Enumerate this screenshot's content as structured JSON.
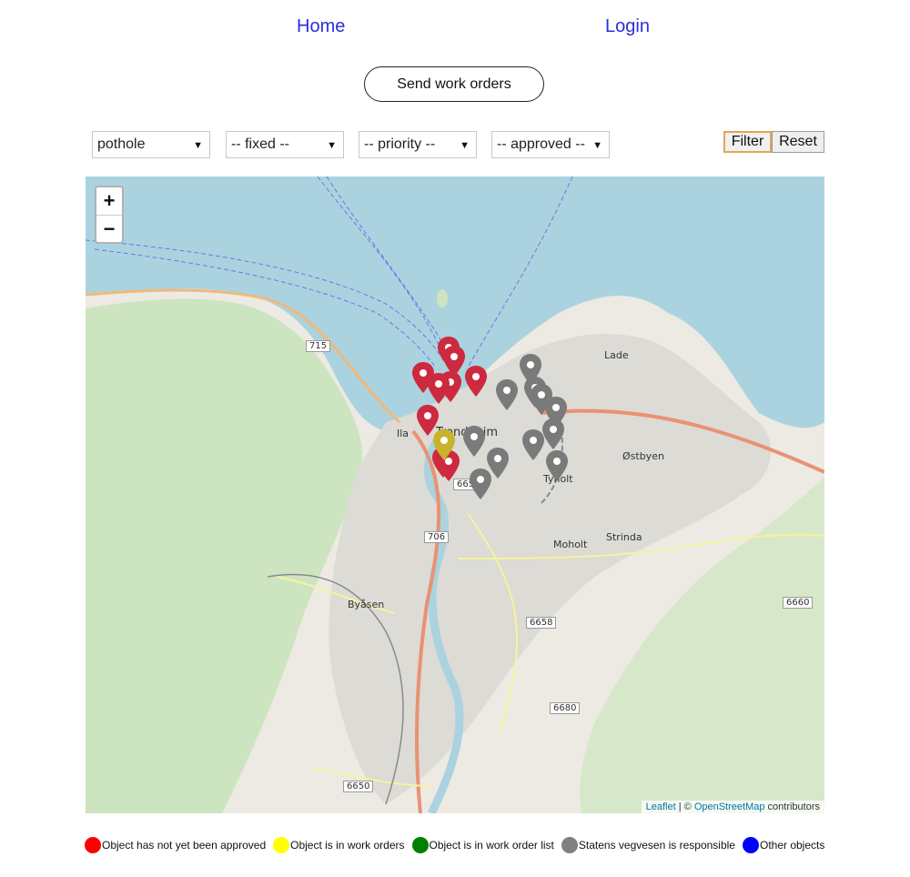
{
  "nav": {
    "home": "Home",
    "login": "Login"
  },
  "send_button": "Send work orders",
  "filters": {
    "category": "pothole",
    "fixed": "-- fixed --",
    "priority": "-- priority --",
    "approved": "-- approved --"
  },
  "buttons": {
    "filter": "Filter",
    "reset": "Reset"
  },
  "map": {
    "zoom_in": "+",
    "zoom_out": "−",
    "attribution": {
      "leaflet": "Leaflet",
      "sep": " | © ",
      "osm": "OpenStreetMap",
      "suffix": " contributors"
    },
    "places": {
      "lade": "Lade",
      "ila": "Ila",
      "trondheim": "Trondheim",
      "ostbyen": "Østbyen",
      "tyholt": "Tyholt",
      "moholt": "Moholt",
      "strinda": "Strinda",
      "byasen": "Byåsen"
    },
    "shields": {
      "r715": "715",
      "r706": "706",
      "r6658": "6658",
      "r6660": "6660",
      "r6680": "6680",
      "r6650": "6650",
      "r6659": "6659"
    },
    "markers": [
      {
        "status": "not-approved",
        "color": "#cd2a3f"
      },
      {
        "status": "in-work-orders",
        "color": "#c8b42a"
      },
      {
        "status": "statens-vegvesen",
        "color": "#7a7a7a"
      }
    ]
  },
  "legend": [
    {
      "label": "Object has not yet been approved",
      "color": "#ff0000"
    },
    {
      "label": "Object is in work orders",
      "color": "#ffff00"
    },
    {
      "label": "Object is in work order list",
      "color": "#008000"
    },
    {
      "label": "Statens vegvesen is responsible",
      "color": "#808080"
    },
    {
      "label": "Other objects",
      "color": "#0000ff"
    }
  ]
}
